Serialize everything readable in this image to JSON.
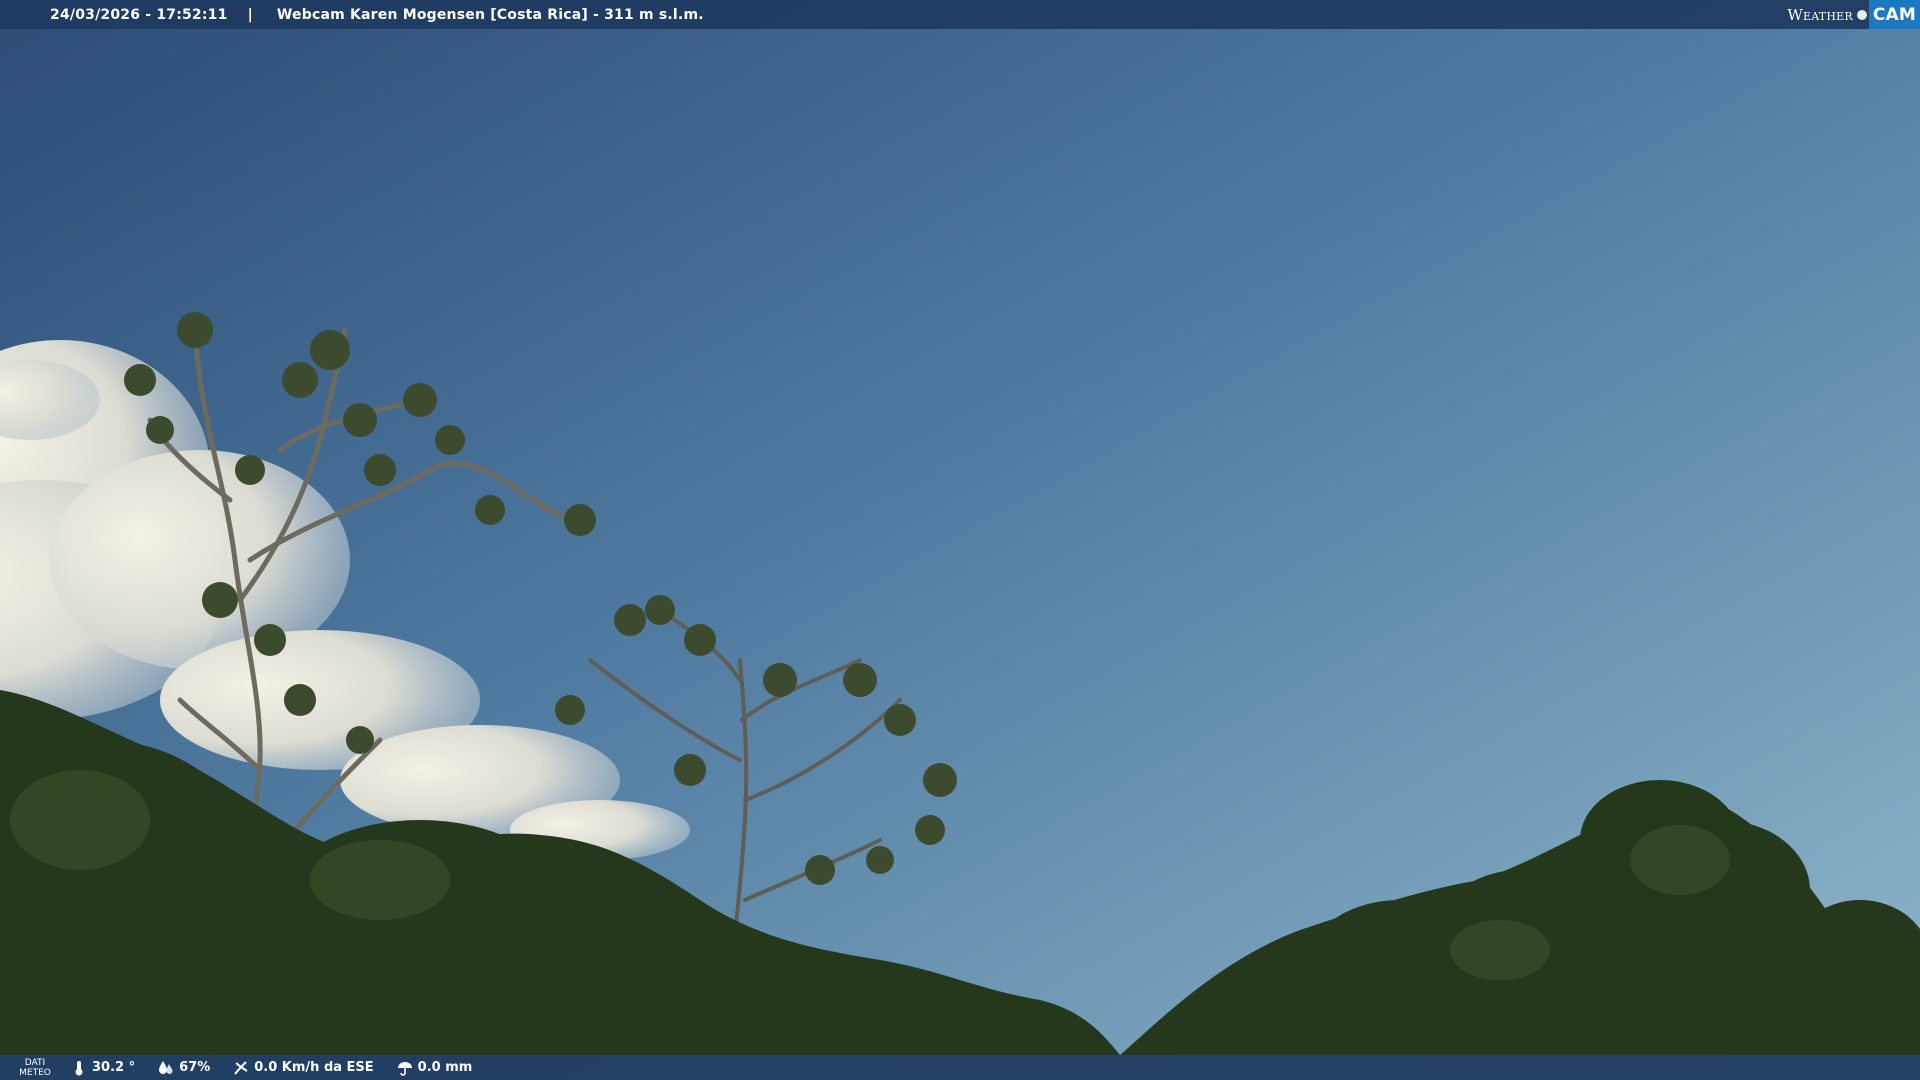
{
  "header": {
    "timestamp": "24/03/2026 - 17:52:11",
    "separator": "|",
    "title": "Webcam Karen Mogensen [Costa Rica]  - 311 m s.l.m.",
    "logo_weather": "Weather",
    "logo_cam": "CAM"
  },
  "footer": {
    "label_line1": "DATI",
    "label_line2": "METEO",
    "temperature": "30.2 °",
    "humidity": "67%",
    "wind": "0.0 Km/h da ESE",
    "rain": "0.0 mm"
  },
  "colors": {
    "bar_background": "#1e3a5f",
    "logo_accent": "#1b78c2",
    "sky_top": "#2e4f78",
    "sky_bottom": "#86aec4",
    "foliage": "#25381c"
  },
  "icons": {
    "temperature": "thermometer-icon",
    "humidity": "humidity-drop-icon",
    "wind": "wind-icon",
    "rain": "umbrella-icon"
  }
}
